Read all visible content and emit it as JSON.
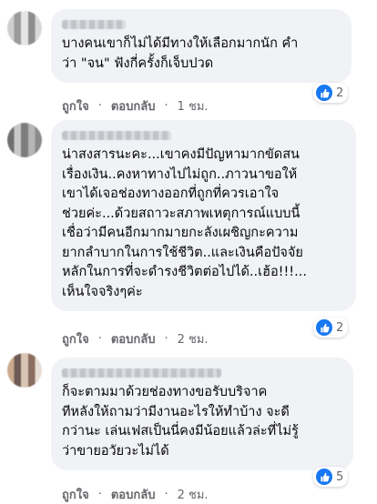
{
  "comments": [
    {
      "text": "บางคนเขาก็ไม่ได้มีทางให้เลือกมากนัก คำ\nว่า \"จน\" ฟังกี่ครั้งก็เจ็บปวด",
      "like_label": "ถูกใจ",
      "reply_label": "ตอบกลับ",
      "time": "1 ชม.",
      "reaction_count": "2"
    },
    {
      "text": "น่าสงสารนะคะ...เขาคงมีปัญหามากขัดสน\nเรื่องเงิน..คงหาทางไปไม่ถูก..ภาวนาขอให้\nเขาได้เจอช่องทางออกที่ถูกที่ควรเอาใจ\nช่วยค่ะ...ด้วยสถาวะสภาพเหตุการณ์แบบนี้\nเชื่อว่ามีคนอีกมากมายกะลังเผชิญกะความ\nยากลำบากในการใช้ชีวิต..และเงินคือปัจจัย\nหลักในการที่จะดำรงชีวิตต่อไปได้..เฮ้อ!!!...\nเห็นใจจริงๆค่ะ",
      "like_label": "ถูกใจ",
      "reply_label": "ตอบกลับ",
      "time": "2 ชม.",
      "reaction_count": "2"
    },
    {
      "text": "ก็จะตามมาด้วยช่องทางขอรับบริจาค\nทีหลังให้ถามว่ามีงานอะไรให้ทำบ้าง จะดี\nกว่านะ เล่นเฟสเป็นนี่คงมีน้อยแล้วล่ะที่ไม่รู้\nว่าขายอวัยวะไม่ได้",
      "like_label": "ถูกใจ",
      "reply_label": "ตอบกลับ",
      "time": "2 ชม.",
      "reaction_count": "5"
    }
  ],
  "colors": {
    "bubble": "#f0f2f5",
    "meta": "#65676b",
    "like_blue": "#1877f2"
  },
  "icons": {
    "reaction": "thumbs-up-icon"
  }
}
